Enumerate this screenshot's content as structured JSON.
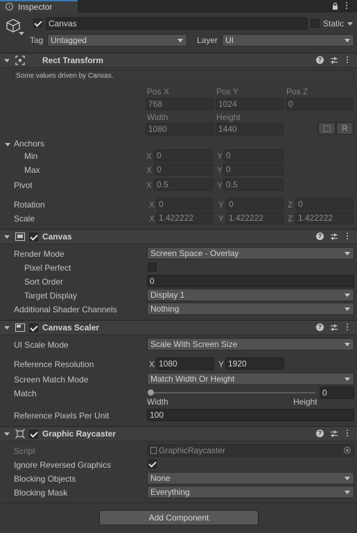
{
  "window": {
    "tab_label": "Inspector"
  },
  "go": {
    "name": "Canvas",
    "static_label": "Static",
    "tag_label": "Tag",
    "tag_value": "Untagged",
    "layer_label": "Layer",
    "layer_value": "UI"
  },
  "rect_transform": {
    "title": "Rect Transform",
    "info": "Some values driven by Canvas.",
    "pos_x_label": "Pos X",
    "pos_y_label": "Pos Y",
    "pos_z_label": "Pos Z",
    "pos_x": "768",
    "pos_y": "1024",
    "pos_z": "0",
    "width_label": "Width",
    "height_label": "Height",
    "width": "1080",
    "height": "1440",
    "r_button": "R",
    "anchors_label": "Anchors",
    "min_label": "Min",
    "max_label": "Max",
    "x_label": "X",
    "y_label": "Y",
    "z_label": "Z",
    "min_x": "0",
    "min_y": "0",
    "max_x": "0",
    "max_y": "0",
    "pivot_label": "Pivot",
    "pivot_x": "0.5",
    "pivot_y": "0.5",
    "rotation_label": "Rotation",
    "rot_x": "0",
    "rot_y": "0",
    "rot_z": "0",
    "scale_label": "Scale",
    "scale_x": "1.422222",
    "scale_y": "1.422222",
    "scale_z": "1.422222"
  },
  "canvas": {
    "title": "Canvas",
    "render_mode_label": "Render Mode",
    "render_mode": "Screen Space - Overlay",
    "pixel_perfect_label": "Pixel Perfect",
    "sort_order_label": "Sort Order",
    "sort_order": "0",
    "target_display_label": "Target Display",
    "target_display": "Display 1",
    "shader_channels_label": "Additional Shader Channels",
    "shader_channels": "Nothing"
  },
  "canvas_scaler": {
    "title": "Canvas Scaler",
    "ui_scale_mode_label": "UI Scale Mode",
    "ui_scale_mode": "Scale With Screen Size",
    "ref_res_label": "Reference Resolution",
    "ref_x": "1080",
    "ref_y": "1920",
    "screen_match_label": "Screen Match Mode",
    "screen_match": "Match Width Or Height",
    "match_label": "Match",
    "match_value": "0",
    "width_caption": "Width",
    "height_caption": "Height",
    "ref_ppu_label": "Reference Pixels Per Unit",
    "ref_ppu": "100"
  },
  "graphic_raycaster": {
    "title": "Graphic Raycaster",
    "script_label": "Script",
    "script_value": "GraphicRaycaster",
    "ignore_reversed_label": "Ignore Reversed Graphics",
    "blocking_objects_label": "Blocking Objects",
    "blocking_objects": "None",
    "blocking_mask_label": "Blocking Mask",
    "blocking_mask": "Everything"
  },
  "add_component_label": "Add Component"
}
